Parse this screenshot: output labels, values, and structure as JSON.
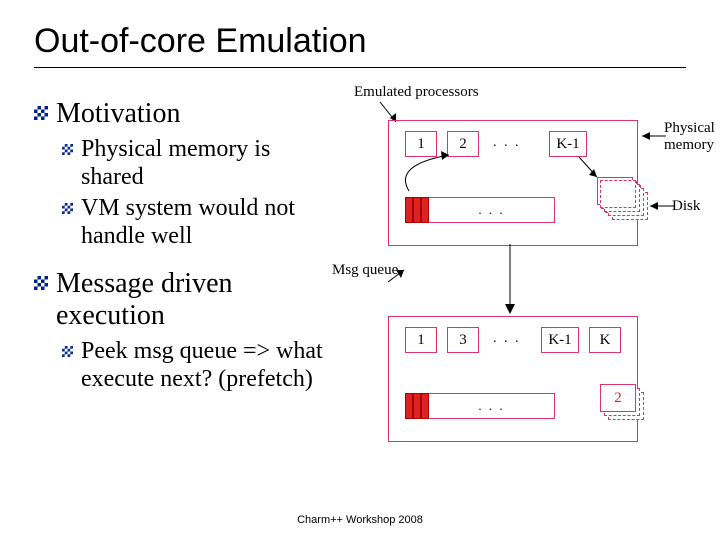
{
  "title": "Out-of-core Emulation",
  "bullets": {
    "motivation": "Motivation",
    "b1": "Physical memory is shared",
    "b2": "VM system would not handle well",
    "msg": "Message driven execution",
    "b3": "Peek msg queue => what execute next? (prefetch)"
  },
  "figure": {
    "emulated": "Emulated processors",
    "physmem": "Physical memory",
    "disk": "Disk",
    "msgqueue": "Msg queue",
    "n1": "1",
    "n2": "2",
    "n3": "3",
    "km1": "K-1",
    "k": "K",
    "dots": ". . .",
    "smalldots": ". . .",
    "ellips": ". . . . . . . ."
  },
  "footer": "Charm++ Workshop 2008"
}
